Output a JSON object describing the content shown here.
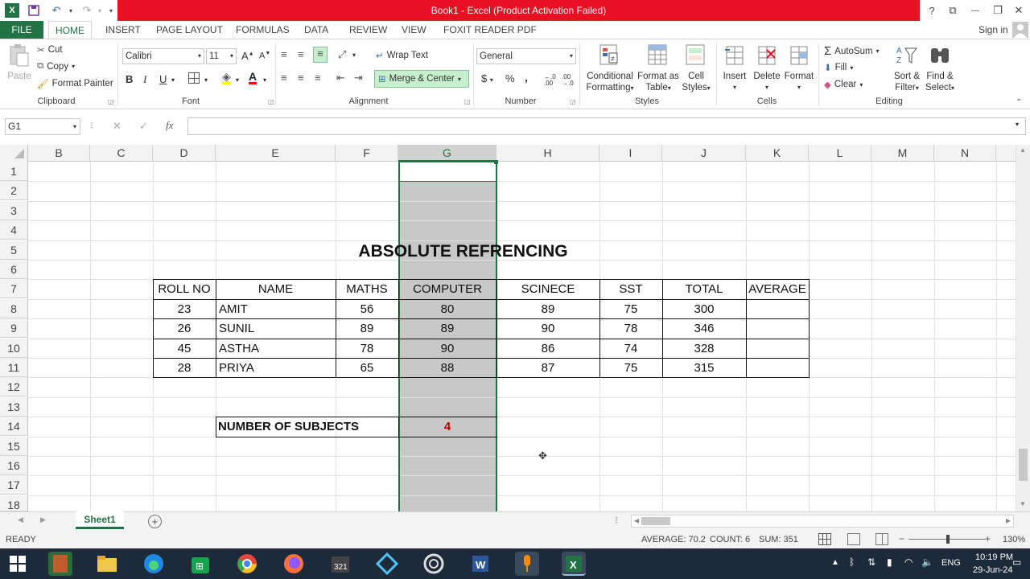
{
  "window": {
    "title": "Book1 -  Excel (Product Activation Failed)",
    "sign_in": "Sign in",
    "help": "?",
    "minimize": "—",
    "restore": "❐",
    "close": "✕"
  },
  "tabs": [
    "FILE",
    "HOME",
    "INSERT",
    "PAGE LAYOUT",
    "FORMULAS",
    "DATA",
    "REVIEW",
    "VIEW",
    "FOXIT READER PDF"
  ],
  "ribbon": {
    "clipboard": {
      "paste": "Paste",
      "cut": "Cut",
      "copy": "Copy",
      "format_painter": "Format Painter",
      "label": "Clipboard"
    },
    "font": {
      "name": "Calibri",
      "size": "11",
      "bold": "B",
      "italic": "I",
      "underline": "U",
      "grow": "A",
      "shrink": "A",
      "label": "Font"
    },
    "alignment": {
      "wrap_text": "Wrap Text",
      "merge_center": "Merge & Center",
      "label": "Alignment"
    },
    "number": {
      "format": "General",
      "currency": "$",
      "percent": "%",
      "comma": ",",
      "inc_dec": "←.0 .00",
      "dec_dec": ".00 →.0",
      "label": "Number"
    },
    "styles": {
      "conditional": "Conditional",
      "formatting": "Formatting",
      "format_as": "Format as",
      "table": "Table",
      "cell": "Cell",
      "cell_styles": "Styles",
      "label": "Styles"
    },
    "cells": {
      "insert": "Insert",
      "delete": "Delete",
      "format": "Format",
      "label": "Cells"
    },
    "editing": {
      "autosum": "AutoSum",
      "fill": "Fill",
      "clear": "Clear",
      "sort": "Sort &",
      "filter": "Filter",
      "find": "Find &",
      "select": "Select",
      "label": "Editing"
    }
  },
  "formula_bar": {
    "name_box": "G1",
    "fx": "fx",
    "cancel": "✕",
    "enter": "✓",
    "formula": ""
  },
  "columns": [
    "B",
    "C",
    "D",
    "E",
    "F",
    "G",
    "H",
    "I",
    "J",
    "K",
    "L",
    "M",
    "N"
  ],
  "rows": [
    "1",
    "2",
    "3",
    "4",
    "5",
    "6",
    "7",
    "8",
    "9",
    "10",
    "11",
    "12",
    "13",
    "14",
    "15",
    "16",
    "17",
    "18"
  ],
  "sheet": {
    "title": "ABSOLUTE REFRENCING",
    "headers": [
      "ROLL NO",
      "NAME",
      "MATHS",
      "COMPUTER",
      "SCINECE",
      "SST",
      "TOTAL",
      "AVERAGE"
    ],
    "data": [
      [
        "23",
        "AMIT",
        "56",
        "80",
        "89",
        "75",
        "300",
        ""
      ],
      [
        "26",
        "SUNIL",
        "89",
        "89",
        "90",
        "78",
        "346",
        ""
      ],
      [
        "45",
        "ASTHA",
        "78",
        "90",
        "86",
        "74",
        "328",
        ""
      ],
      [
        "28",
        "PRIYA",
        "65",
        "88",
        "87",
        "75",
        "315",
        ""
      ]
    ],
    "subjects_label": "NUMBER OF SUBJECTS",
    "subjects_value": "4",
    "subjects_color": "#c00000"
  },
  "sheet_tabs": {
    "active": "Sheet1",
    "add": "+"
  },
  "status": {
    "ready": "READY",
    "average": "AVERAGE: 70.2",
    "count": "COUNT: 6",
    "sum": "SUM: 351",
    "zoom": "130%"
  },
  "taskbar": {
    "lang": "ENG",
    "time": "10:19 PM",
    "date": "29-Jun-24"
  },
  "colors": {
    "excel_green": "#217346",
    "title_red": "#e81123",
    "selection": "#c8c8c8"
  }
}
